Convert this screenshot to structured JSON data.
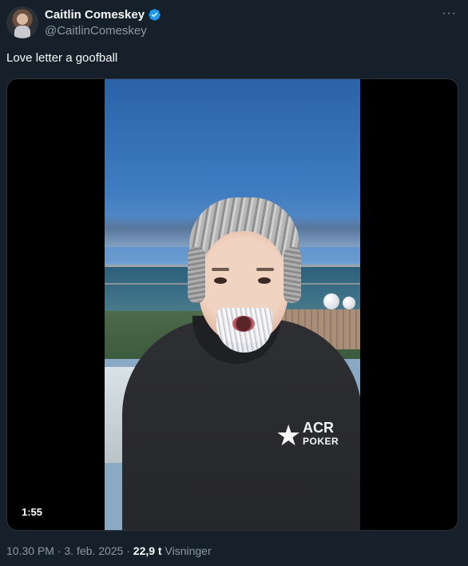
{
  "author": {
    "display_name": "Caitlin Comeskey",
    "handle": "@CaitlinComeskey",
    "verified": true,
    "verified_color": "#1d9bf0"
  },
  "more_label": "···",
  "tweet": {
    "text": "Love letter a goofball"
  },
  "media": {
    "type": "video",
    "duration": "1:55",
    "logo": {
      "brand_top": "ACR",
      "brand_bottom": "POKER"
    }
  },
  "footer": {
    "time": "10.30 PM",
    "separator": "·",
    "date": "3. feb. 2025",
    "views_count": "22,9 t",
    "views_label": "Visninger"
  },
  "icons": [
    "verified-badge-icon",
    "more-icon",
    "play-video"
  ]
}
